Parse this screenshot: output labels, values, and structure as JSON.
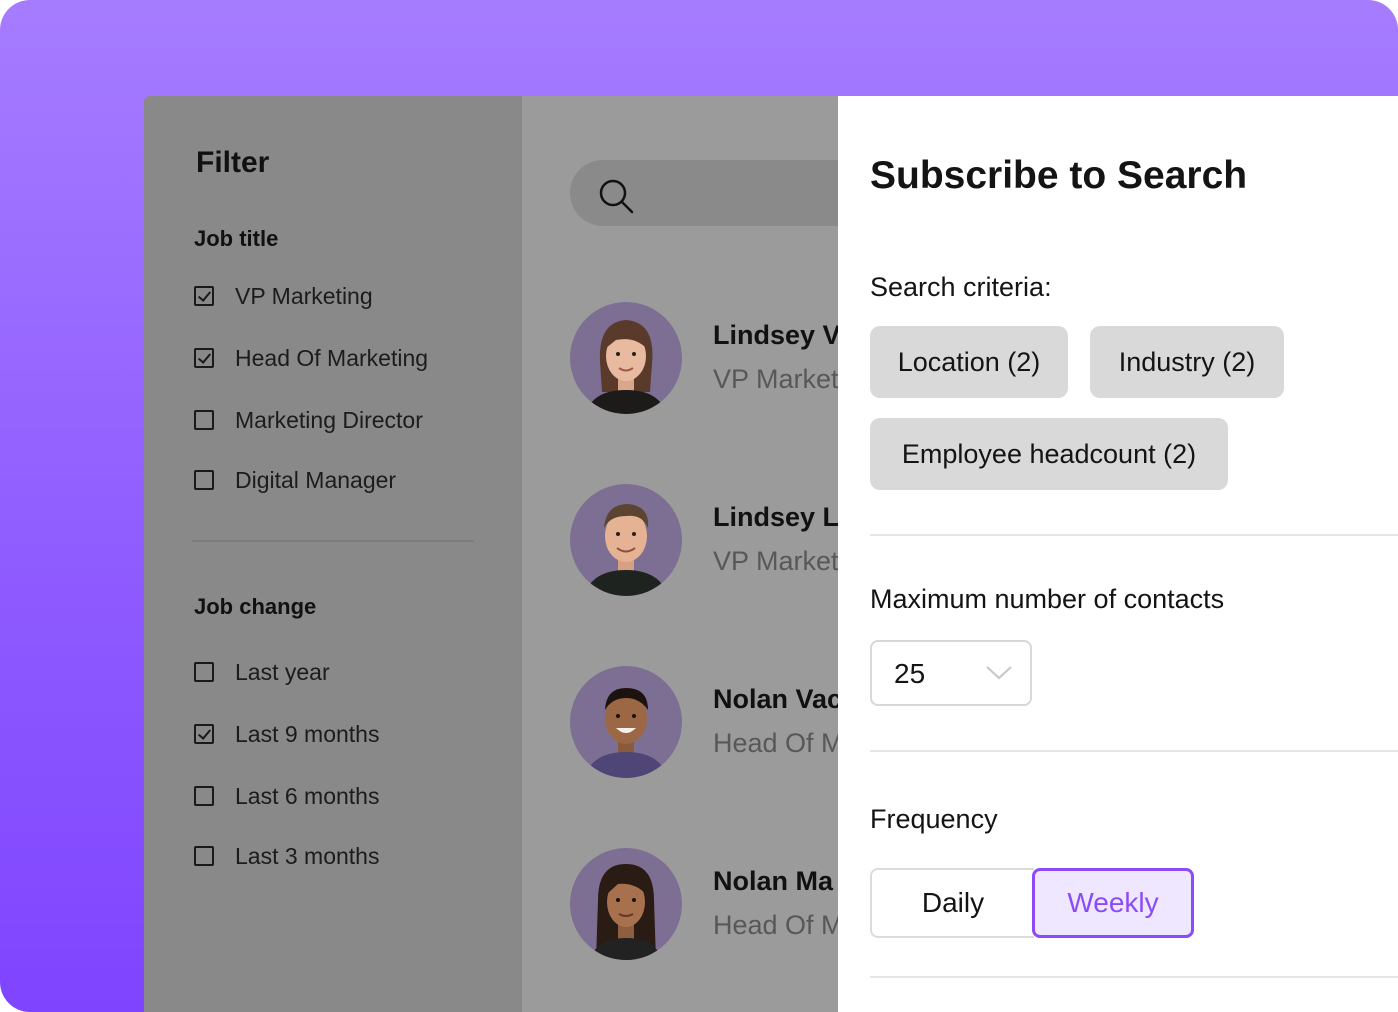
{
  "filter": {
    "title": "Filter",
    "job_title": {
      "heading": "Job title",
      "options": [
        {
          "label": "VP Marketing",
          "checked": true
        },
        {
          "label": "Head Of Marketing",
          "checked": true
        },
        {
          "label": "Marketing Director",
          "checked": false
        },
        {
          "label": "Digital Manager",
          "checked": false
        }
      ]
    },
    "job_change": {
      "heading": "Job change",
      "options": [
        {
          "label": "Last year",
          "checked": false
        },
        {
          "label": "Last 9 months",
          "checked": true
        },
        {
          "label": "Last 6 months",
          "checked": false
        },
        {
          "label": "Last 3 months",
          "checked": false
        }
      ]
    }
  },
  "results": {
    "search_icon": "search-icon",
    "people": [
      {
        "name": "Lindsey Ve",
        "role": "VP Market"
      },
      {
        "name": "Lindsey Lu",
        "role": "VP Market"
      },
      {
        "name": "Nolan Vac",
        "role": "Head Of M"
      },
      {
        "name": "Nolan  Ma",
        "role": "Head Of M"
      }
    ]
  },
  "subscribe": {
    "title": "Subscribe to Search",
    "criteria_label": "Search criteria:",
    "chips": [
      "Location (2)",
      "Industry (2)",
      "Employee headcount (2)"
    ],
    "max_label": "Maximum number of contacts",
    "max_value": "25",
    "frequency_label": "Frequency",
    "frequency_options": [
      "Daily",
      "Weekly"
    ],
    "frequency_selected": "Weekly"
  },
  "colors": {
    "accent": "#8b4cf7",
    "accent_bg": "#efe6ff",
    "background_gradient_top": "#a67cff",
    "background_gradient_bottom": "#7f44ff"
  }
}
